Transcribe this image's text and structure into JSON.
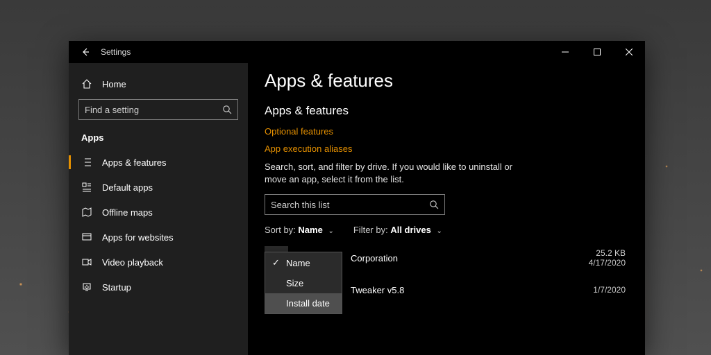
{
  "window": {
    "title": "Settings"
  },
  "sidebar": {
    "home": "Home",
    "find_placeholder": "Find a setting",
    "section": "Apps",
    "items": [
      {
        "label": "Apps & features"
      },
      {
        "label": "Default apps"
      },
      {
        "label": "Offline maps"
      },
      {
        "label": "Apps for websites"
      },
      {
        "label": "Video playback"
      },
      {
        "label": "Startup"
      }
    ]
  },
  "main": {
    "h1": "Apps & features",
    "h2": "Apps & features",
    "link1": "Optional features",
    "link2": "App execution aliases",
    "desc": "Search, sort, and filter by drive. If you would like to uninstall or move an app, select it from the list.",
    "search_placeholder": "Search this list",
    "sort_label": "Sort by:",
    "sort_value": "Name",
    "filter_label": "Filter by:",
    "filter_value": "All drives",
    "sort_options": [
      "Name",
      "Size",
      "Install date"
    ],
    "apps": [
      {
        "name": "",
        "publisher": "Corporation",
        "size": "25.2 KB",
        "date": "4/17/2020"
      },
      {
        "name": "",
        "publisher": "Tweaker v5.8",
        "size": "",
        "date": "1/7/2020"
      }
    ]
  }
}
